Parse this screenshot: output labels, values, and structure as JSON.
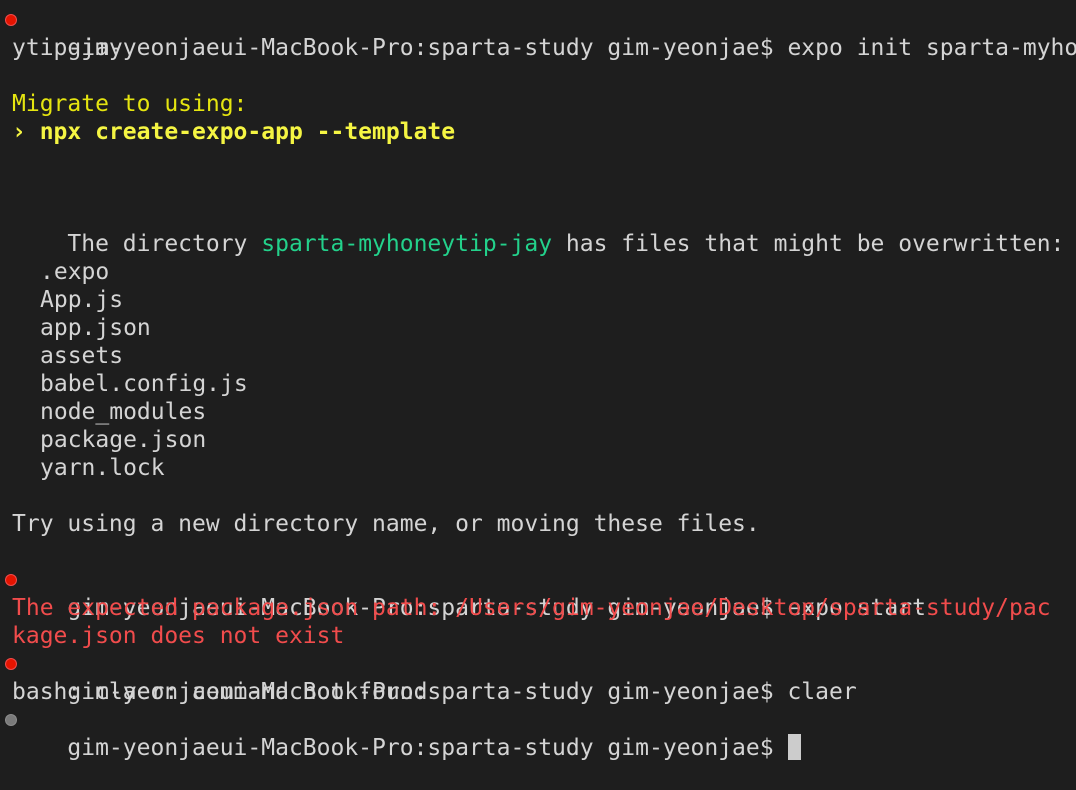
{
  "terminal": {
    "prompt": "gim-yeonjaeui-MacBook-Pro:sparta-study gim-yeonjae$ ",
    "cmd1": "expo init sparta-myhone",
    "cmd1_wrap": "ytip-jay",
    "migrate_label": "Migrate to using:",
    "migrate_cmd": "› npx create-expo-app --template",
    "dir_prefix": "The directory ",
    "dir_name": "sparta-myhoneytip-jay",
    "dir_suffix": " has files that might be overwritten:",
    "files": [
      ".expo",
      "App.js",
      "app.json",
      "assets",
      "babel.config.js",
      "node_modules",
      "package.json",
      "yarn.lock"
    ],
    "try_msg": "Try using a new directory name, or moving these files.",
    "cmd2": "expo start",
    "error_line1": "The expected package.json path: /Users/gim-yeonjae/Desktop/sparta-study/pac",
    "error_line2": "kage.json does not exist",
    "cmd3": "claer",
    "bash_error": "bash: claer: command not found"
  },
  "colors": {
    "background": "#1e1e1e",
    "text": "#d4d4d4",
    "yellow": "#e5e510",
    "green": "#23d18b",
    "red": "#f14c4c",
    "error_dot": "#e51400"
  }
}
